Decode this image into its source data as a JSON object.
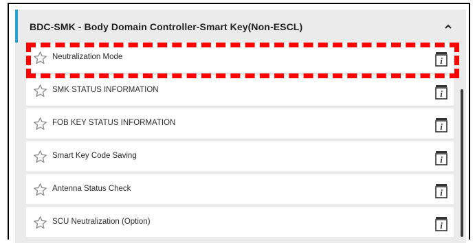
{
  "panel": {
    "title": "BDC-SMK - Body Domain Controller-Smart Key(Non-ESCL)",
    "collapse_icon": "chevron-up-icon",
    "accent_color": "#2a9fd6"
  },
  "items": [
    {
      "label": "Neutralization Mode",
      "favorite_icon": "star-outline-icon",
      "info_icon": "info-icon"
    },
    {
      "label": "SMK STATUS INFORMATION",
      "favorite_icon": "star-outline-icon",
      "info_icon": "info-icon"
    },
    {
      "label": "FOB KEY STATUS INFORMATION",
      "favorite_icon": "star-outline-icon",
      "info_icon": "info-icon"
    },
    {
      "label": "Smart Key Code Saving",
      "favorite_icon": "star-outline-icon",
      "info_icon": "info-icon"
    },
    {
      "label": "Antenna Status Check",
      "favorite_icon": "star-outline-icon",
      "info_icon": "info-icon"
    },
    {
      "label": "SCU Neutralization (Option)",
      "favorite_icon": "star-outline-icon",
      "info_icon": "info-icon"
    }
  ],
  "annotation": {
    "highlight_color": "#ff0000",
    "highlighted_item": "Neutralization Mode"
  }
}
